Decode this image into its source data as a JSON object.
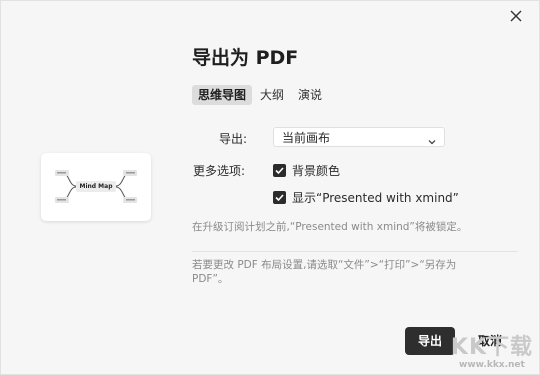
{
  "dialog": {
    "title": "导出为 PDF",
    "tabs": [
      {
        "label": "思维导图",
        "active": true
      },
      {
        "label": "大纲",
        "active": false
      },
      {
        "label": "演说",
        "active": false
      }
    ],
    "thumbnail": {
      "center_label": "Mind Map"
    },
    "export": {
      "label": "导出:",
      "selected": "当前画布"
    },
    "more_options": {
      "label": "更多选项:",
      "options": [
        {
          "label": "背景颜色",
          "checked": true
        },
        {
          "label": "显示“Presented with xmind”",
          "checked": true
        }
      ]
    },
    "note_lock": "在升级订阅计划之前,“Presented with xmind”将被锁定。",
    "note_layout": "若要更改 PDF 布局设置,请选取“文件”>“打印”>“另存为 PDF”。",
    "buttons": {
      "export": "导出",
      "cancel": "取消"
    },
    "watermark": {
      "logo": "KK下载",
      "url": "www.kkx.net"
    },
    "colors": {
      "accent": "#2e2e2e",
      "background": "#f6f6f6"
    }
  }
}
